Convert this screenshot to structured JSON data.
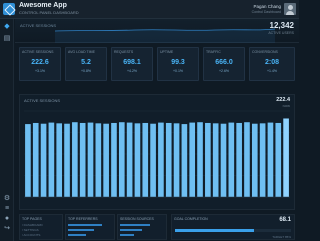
{
  "app": {
    "title": "Awesome App",
    "subtitle": "CONTROL PANEL DASHBOARD"
  },
  "user": {
    "name": "Pagan Chang",
    "subtitle": "Control Dashboard"
  },
  "hero": {
    "label": "ACTIVE SESSIONS",
    "value": "12,342",
    "sub": "ACTIVE USERS"
  },
  "kpis": [
    {
      "title": "ACTIVE SESSIONS",
      "value": "222.6",
      "delta": "+3.1%"
    },
    {
      "title": "AVG LOAD TIME",
      "value": "5.2",
      "delta": "+0.8%"
    },
    {
      "title": "REQUESTS",
      "value": "698.1",
      "delta": "+4.2%"
    },
    {
      "title": "UPTIME",
      "value": "99.3",
      "delta": "+0.1%"
    },
    {
      "title": "TRAFFIC",
      "value": "666.0",
      "delta": "+2.6%"
    },
    {
      "title": "CONVERSIONS",
      "value": "2:08",
      "delta": "+1.4%"
    }
  ],
  "chart": {
    "title": "ACTIVE SESSIONS",
    "current": "222.4",
    "current_sub": "NOW"
  },
  "chart_data": {
    "type": "bar",
    "values": [
      195,
      198,
      196,
      199,
      197,
      196,
      200,
      198,
      199,
      197,
      196,
      198,
      200,
      199,
      197,
      198,
      196,
      199,
      198,
      197,
      195,
      199,
      200,
      198,
      197,
      196,
      199,
      198,
      200,
      196,
      197,
      199,
      198,
      210
    ],
    "highlight_last": true,
    "ylim": [
      0,
      230
    ],
    "grid": true
  },
  "bottom_panels": {
    "p1_title": "TOP PAGES",
    "p1_lines": [
      "/ DASHBOARD",
      "/ SETTINGS",
      "/ ACCOUNTS"
    ],
    "p2_title": "TOP REFERRERS",
    "p3_title": "SESSION SOURCES",
    "p4_title": "GOAL COMPLETION",
    "p4_value": "68.1",
    "p4_sub": "TARGET 85%",
    "p4_progress": 0.68
  },
  "colors": {
    "accent": "#3fa8f0",
    "bar": "#6fbff2",
    "bar_highlight": "#8fd3ff",
    "background": "#0f1a24"
  },
  "icons": [
    "dashboard-icon",
    "chart-icon",
    "list-icon",
    "settings-icon",
    "user-icon",
    "logout-icon"
  ]
}
